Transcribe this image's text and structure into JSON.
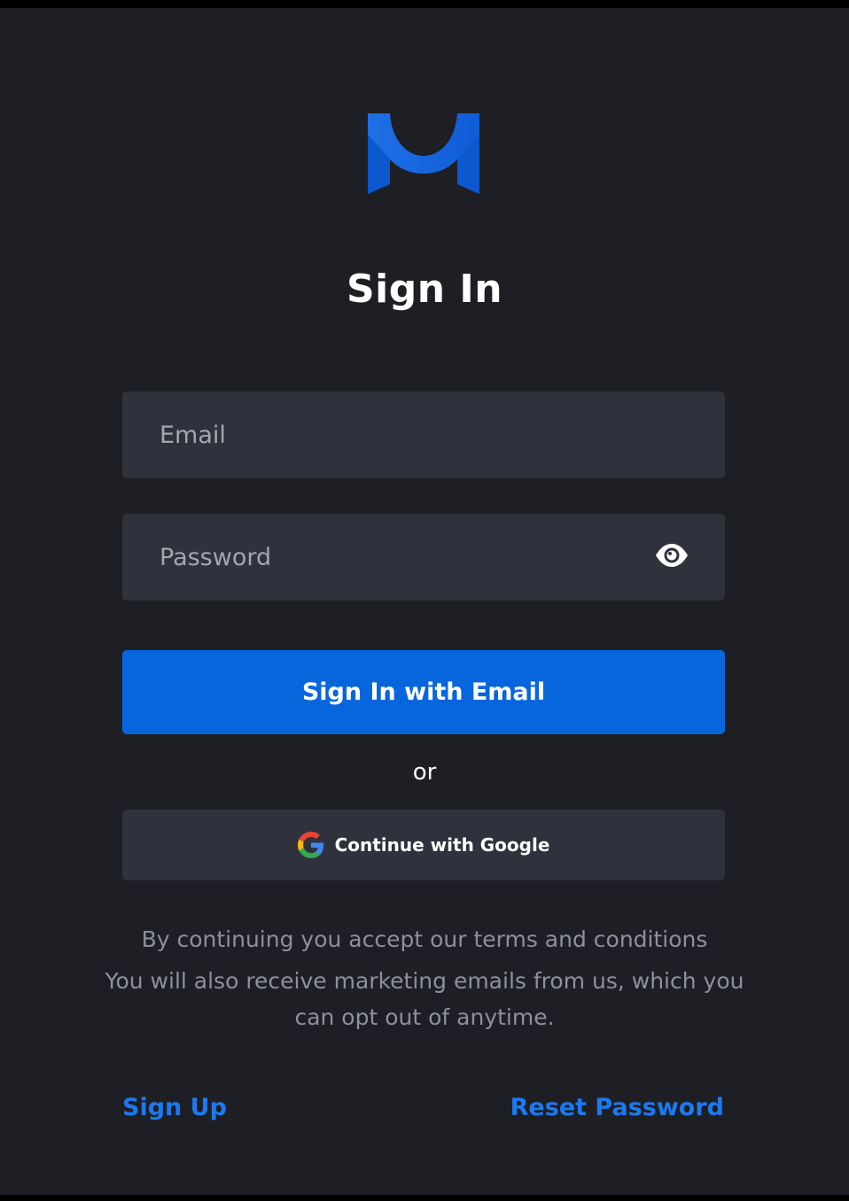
{
  "brand": {
    "logo_icon": "m-logo-icon",
    "logo_color": "#1769e8"
  },
  "title": "Sign In",
  "email_field": {
    "placeholder": "Email",
    "value": ""
  },
  "password_field": {
    "placeholder": "Password",
    "value": "",
    "toggle_icon": "eye-icon"
  },
  "primary_button": {
    "label": "Sign In with Email",
    "color": "#0866dd"
  },
  "divider_text": "or",
  "google_button": {
    "label": "Continue with Google",
    "icon": "google-icon"
  },
  "terms": {
    "line1": "By continuing you accept our terms and conditions",
    "line2": "You will also receive marketing emails from us, which you can opt out of anytime."
  },
  "links": {
    "sign_up": "Sign Up",
    "reset_password": "Reset Password",
    "color": "#1c79f0"
  },
  "colors": {
    "background": "#1e1f24",
    "field_background": "#2f323c",
    "muted_text": "#8d909a"
  }
}
